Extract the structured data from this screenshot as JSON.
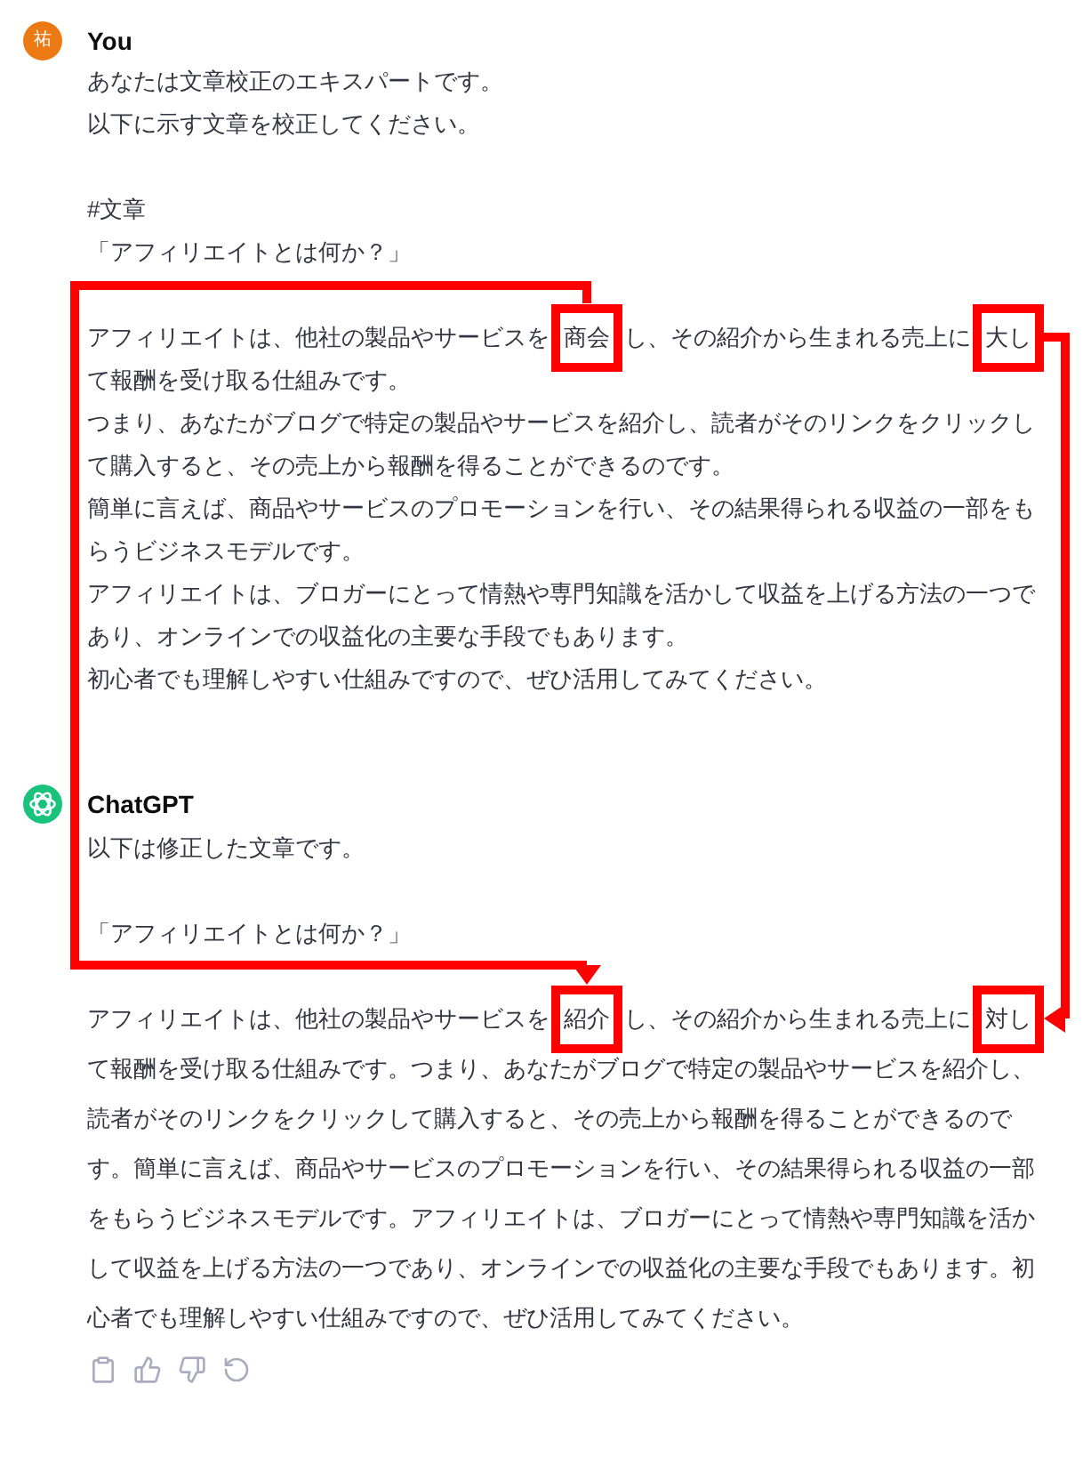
{
  "messages": [
    {
      "kind": "user",
      "author": "You",
      "avatar_text": "祐",
      "blocks": [
        [
          [
            {
              "text": "あなたは文章校正のエキスパートです。",
              "boxed": false
            }
          ],
          [
            {
              "text": "以下に示す文章を校正してください。",
              "boxed": false
            }
          ]
        ],
        [
          [
            {
              "text": "#文章",
              "boxed": false
            }
          ],
          [
            {
              "text": "「アフィリエイトとは何か？」",
              "boxed": false
            }
          ]
        ],
        [
          [
            {
              "text": "アフィリエイトは、他社の製品やサービスを",
              "boxed": false
            },
            {
              "text": "商会",
              "boxed": true
            },
            {
              "text": "し、その紹介から生まれる売上に",
              "boxed": false
            },
            {
              "text": "大し",
              "boxed": true
            },
            {
              "text": "て報酬を受け取る仕組みです。",
              "boxed": false
            }
          ],
          [
            {
              "text": "つまり、あなたがブログで特定の製品やサービスを紹介し、読者がそのリンクをクリックして購入すると、その売上から報酬を得ることができるのです。",
              "boxed": false
            }
          ],
          [
            {
              "text": "簡単に言えば、商品やサービスのプロモーションを行い、その結果得られる収益の一部をもらうビジネスモデルです。",
              "boxed": false
            }
          ],
          [
            {
              "text": "アフィリエイトは、ブロガーにとって情熱や専門知識を活かして収益を上げる方法の一つであり、オンラインでの収益化の主要な手段でもあります。",
              "boxed": false
            }
          ],
          [
            {
              "text": "初心者でも理解しやすい仕組みですので、ぜひ活用してみてください。",
              "boxed": false
            }
          ]
        ]
      ]
    },
    {
      "kind": "assistant",
      "author": "ChatGPT",
      "blocks": [
        [
          [
            {
              "text": "以下は修正した文章です。",
              "boxed": false
            }
          ]
        ],
        [
          [
            {
              "text": "「アフィリエイトとは何か？」",
              "boxed": false
            }
          ]
        ],
        [
          [
            {
              "text": "アフィリエイトは、他社の製品やサービスを",
              "boxed": false
            },
            {
              "text": "紹介",
              "boxed": true
            },
            {
              "text": "し、その紹介から生まれる売上に",
              "boxed": false
            },
            {
              "text": "対し",
              "boxed": true
            },
            {
              "text": "て報酬を受け取る仕組みです。つまり、あなたがブログで特定の製品やサービスを紹介し、読者がそのリンクをクリックして購入すると、その売上から報酬を得ることができるのです。簡単に言えば、商品やサービスのプロモーションを行い、その結果得られる収益の一部をもらうビジネスモデルです。アフィリエイトは、ブロガーにとって情熱や専門知識を活かして収益を上げる方法の一つであり、オンラインでの収益化の主要な手段でもあります。初心者でも理解しやすい仕組みですので、ぜひ活用してみてください。",
              "boxed": false
            }
          ]
        ]
      ]
    }
  ]
}
